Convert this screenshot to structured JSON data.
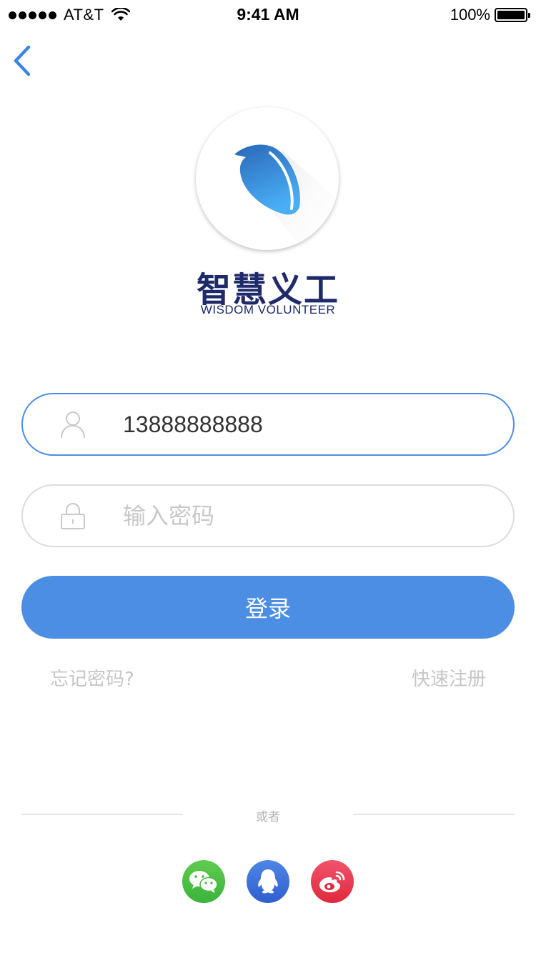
{
  "status_bar": {
    "carrier": "AT&T",
    "time": "9:41 AM",
    "battery": "100%"
  },
  "brand": {
    "name_cn": "智慧义工",
    "name_en": "WISDOM VOLUNTEER"
  },
  "form": {
    "phone_value": "13888888888",
    "password_placeholder": "输入密码",
    "login_label": "登录"
  },
  "links": {
    "forgot": "忘记密码?",
    "register": "快速注册"
  },
  "divider": {
    "text": "或者"
  },
  "social": {
    "items": [
      "wechat-icon",
      "qq-icon",
      "weibo-icon"
    ]
  },
  "colors": {
    "accent": "#4c8ee3",
    "brand_text": "#1f2a6b",
    "wechat": "#3bb33a",
    "qq": "#2f5fd0",
    "weibo": "#e0283d"
  }
}
